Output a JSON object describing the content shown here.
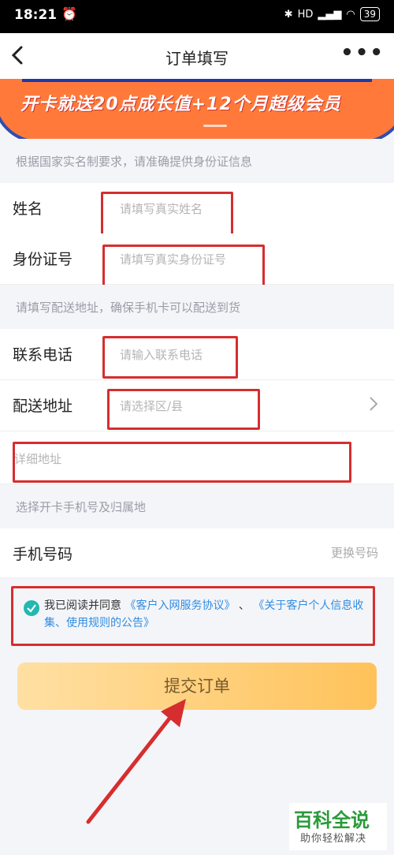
{
  "status_bar": {
    "time": "18:21",
    "signal_text": "HD",
    "battery": "39"
  },
  "nav": {
    "title": "订单填写"
  },
  "banner": {
    "text": "开卡就送20点成长值+12个月超级会员"
  },
  "sections": {
    "identity_hint": "根据国家实名制要求，请准确提供身份证信息",
    "address_hint": "请填写配送地址，确保手机卡可以配送到货",
    "number_hint": "选择开卡手机号及归属地"
  },
  "form": {
    "name": {
      "label": "姓名",
      "placeholder": "请填写真实姓名"
    },
    "id_number": {
      "label": "身份证号",
      "placeholder": "请填写真实身份证号"
    },
    "phone": {
      "label": "联系电话",
      "placeholder": "请输入联系电话"
    },
    "region": {
      "label": "配送地址",
      "placeholder": "请选择区/县"
    },
    "detail_address": {
      "placeholder": "详细地址"
    },
    "mobile_number": {
      "label": "手机号码",
      "action": "更换号码"
    }
  },
  "agreement": {
    "prefix": "我已阅读并同意",
    "link1": "《客户入网服务协议》",
    "sep": "、",
    "link2": "《关于客户个人信息收集、使用规则的公告》"
  },
  "submit_label": "提交订单",
  "watermark": {
    "title": "百科全说",
    "subtitle": "助你轻松解决"
  },
  "colors": {
    "accent_teal": "#23b8b0",
    "annotation_red": "#d62e2e",
    "link_blue": "#2f8de3",
    "button_gold": "#ffc25a"
  }
}
